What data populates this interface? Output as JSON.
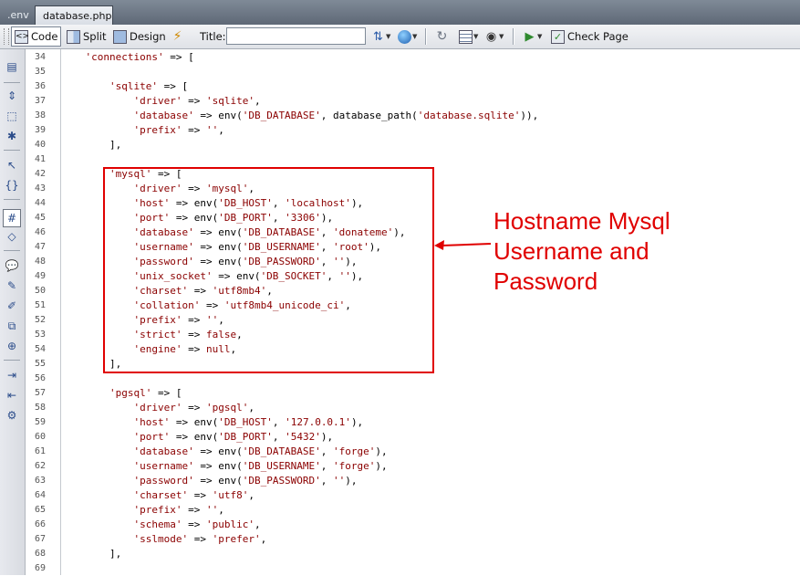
{
  "tabs": [
    {
      "label": ".env",
      "active": false
    },
    {
      "label": "database.php",
      "active": true
    }
  ],
  "toolbar": {
    "code_label": "Code",
    "split_label": "Split",
    "design_label": "Design",
    "title_label": "Title:",
    "title_value": "",
    "check_page_label": "Check Page"
  },
  "line_numbers": [
    "34",
    "35",
    "36",
    "37",
    "38",
    "39",
    "40",
    "41",
    "42",
    "43",
    "44",
    "45",
    "46",
    "47",
    "48",
    "49",
    "50",
    "51",
    "52",
    "53",
    "54",
    "55",
    "56",
    "57",
    "58",
    "59",
    "60",
    "61",
    "62",
    "63",
    "64",
    "65",
    "66",
    "67",
    "68",
    "69"
  ],
  "code_lines": [
    "    'connections' => [",
    "",
    "        'sqlite' => [",
    "            'driver' => 'sqlite',",
    "            'database' => env('DB_DATABASE', database_path('database.sqlite')),",
    "            'prefix' => '',",
    "        ],",
    "",
    "        'mysql' => [",
    "            'driver' => 'mysql',",
    "            'host' => env('DB_HOST', 'localhost'),",
    "            'port' => env('DB_PORT', '3306'),",
    "            'database' => env('DB_DATABASE', 'donateme'),",
    "            'username' => env('DB_USERNAME', 'root'),",
    "            'password' => env('DB_PASSWORD', ''),",
    "            'unix_socket' => env('DB_SOCKET', ''),",
    "            'charset' => 'utf8mb4',",
    "            'collation' => 'utf8mb4_unicode_ci',",
    "            'prefix' => '',",
    "            'strict' => false,",
    "            'engine' => null,",
    "        ],",
    "",
    "        'pgsql' => [",
    "            'driver' => 'pgsql',",
    "            'host' => env('DB_HOST', '127.0.0.1'),",
    "            'port' => env('DB_PORT', '5432'),",
    "            'database' => env('DB_DATABASE', 'forge'),",
    "            'username' => env('DB_USERNAME', 'forge'),",
    "            'password' => env('DB_PASSWORD', ''),",
    "            'charset' => 'utf8',",
    "            'prefix' => '',",
    "            'schema' => 'public',",
    "            'sslmode' => 'prefer',",
    "        ],",
    ""
  ],
  "annotation": {
    "lines": [
      "Hostname Mysql",
      "Username and",
      "Password"
    ],
    "color": "#e00000"
  },
  "colors": {
    "string": "#8b0000",
    "keyword_blue": "#0000cc",
    "tabbar": "#6b7582"
  }
}
